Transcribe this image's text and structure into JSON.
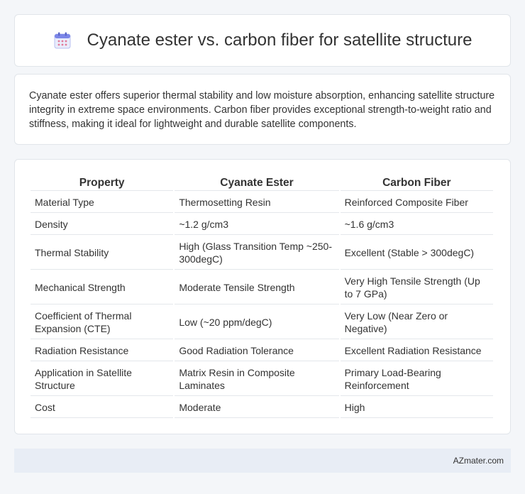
{
  "header": {
    "title": "Cyanate ester vs. carbon fiber for satellite structure",
    "icon": "calendar-icon"
  },
  "summary": {
    "text": "Cyanate ester offers superior thermal stability and low moisture absorption, enhancing satellite structure integrity in extreme space environments. Carbon fiber provides exceptional strength-to-weight ratio and stiffness, making it ideal for lightweight and durable satellite components."
  },
  "table": {
    "headers": [
      "Property",
      "Cyanate Ester",
      "Carbon Fiber"
    ],
    "rows": [
      [
        "Material Type",
        "Thermosetting Resin",
        "Reinforced Composite Fiber"
      ],
      [
        "Density",
        "~1.2 g/cm3",
        "~1.6 g/cm3"
      ],
      [
        "Thermal Stability",
        "High (Glass Transition Temp ~250-300degC)",
        "Excellent (Stable > 300degC)"
      ],
      [
        "Mechanical Strength",
        "Moderate Tensile Strength",
        "Very High Tensile Strength (Up to 7 GPa)"
      ],
      [
        "Coefficient of Thermal Expansion (CTE)",
        "Low (~20 ppm/degC)",
        "Very Low (Near Zero or Negative)"
      ],
      [
        "Radiation Resistance",
        "Good Radiation Tolerance",
        "Excellent Radiation Resistance"
      ],
      [
        "Application in Satellite Structure",
        "Matrix Resin in Composite Laminates",
        "Primary Load-Bearing Reinforcement"
      ],
      [
        "Cost",
        "Moderate",
        "High"
      ]
    ]
  },
  "footer": {
    "site": "AZmater.com"
  },
  "colors": {
    "background": "#f4f6f9",
    "card": "#ffffff",
    "footer": "#e8edf5",
    "icon_accent": "#7b86e8"
  }
}
